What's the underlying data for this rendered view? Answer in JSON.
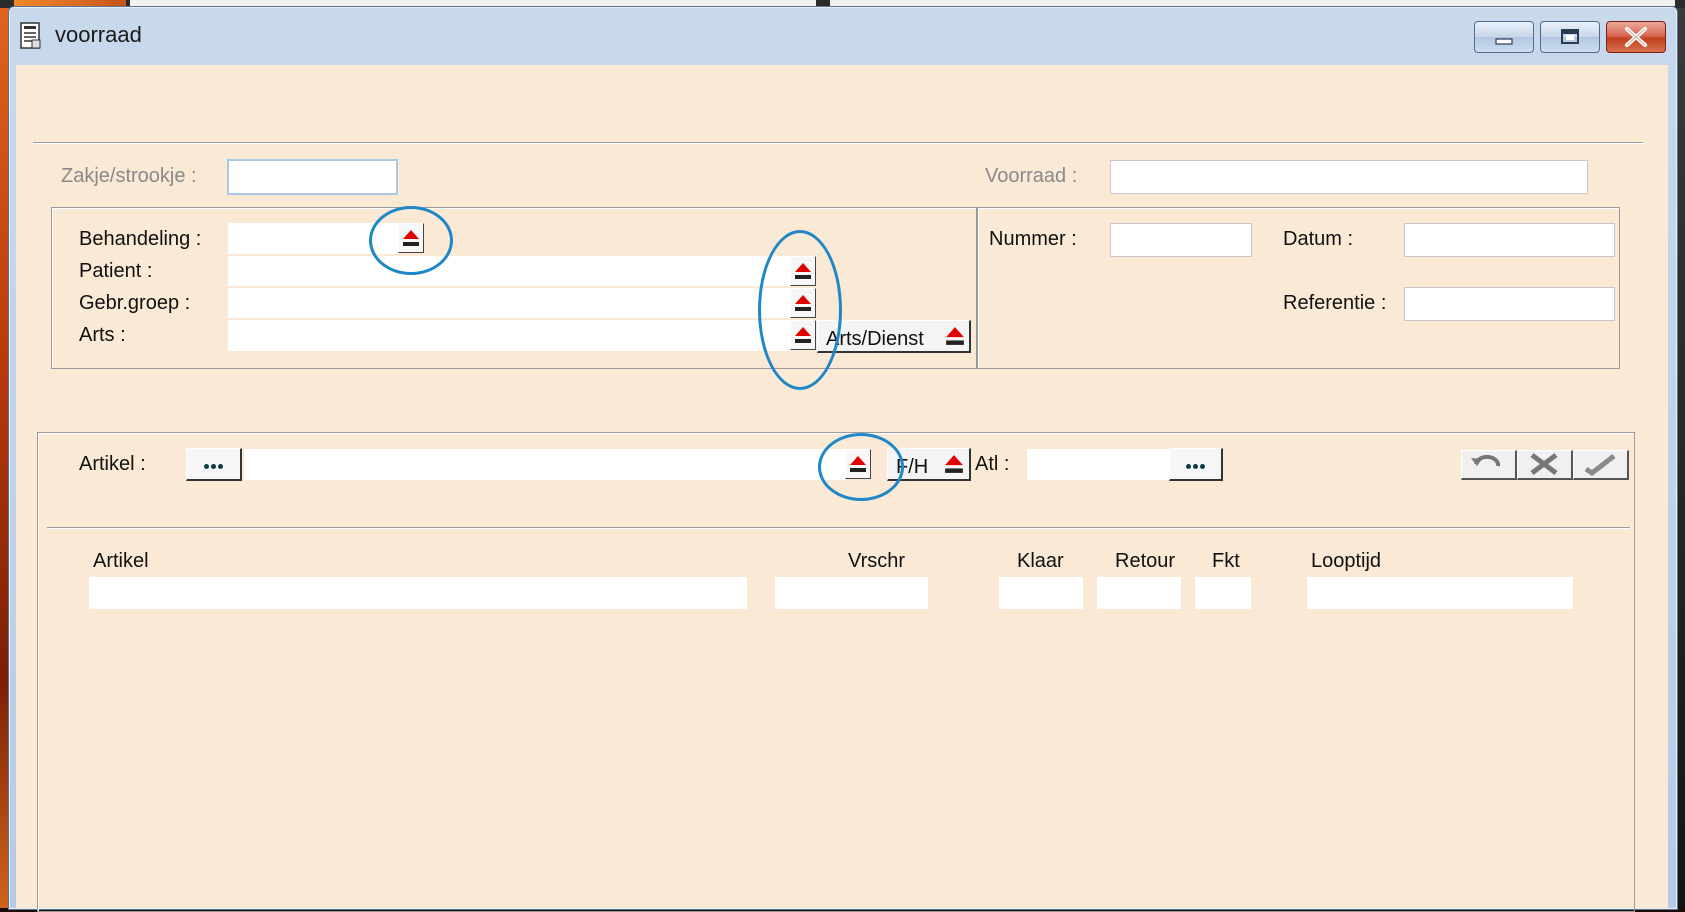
{
  "window": {
    "title": "voorraad"
  },
  "header": {
    "zakje_label": "Zakje/strookje :",
    "zakje_value": "",
    "voorraad_label": "Voorraad :",
    "voorraad_value": ""
  },
  "left_group": {
    "behandeling_label": "Behandeling :",
    "patient_label": "Patient :",
    "gebrgroep_label": "Gebr.groep :",
    "arts_label": "Arts :",
    "arts_dienst_button": "Arts/Dienst"
  },
  "right_group": {
    "nummer_label": "Nummer :",
    "datum_label": "Datum :",
    "referentie_label": "Referentie :"
  },
  "artikel_bar": {
    "artikel_label": "Artikel :",
    "fh_button": "F/H",
    "atl_label": "Atl :"
  },
  "table": {
    "columns": [
      "Artikel",
      "Vrschr",
      "Klaar",
      "Retour",
      "Fkt",
      "Looptijd"
    ]
  },
  "icons": [
    "document-icon",
    "minimize-icon",
    "maximize-icon",
    "close-icon",
    "eject-icon",
    "ellipsis-icon",
    "undo-icon",
    "cancel-icon",
    "confirm-icon"
  ],
  "colors": {
    "client_bg": "#f9e9d5",
    "annotation_circle": "#1f86c7",
    "eject_red": "#e00000"
  }
}
